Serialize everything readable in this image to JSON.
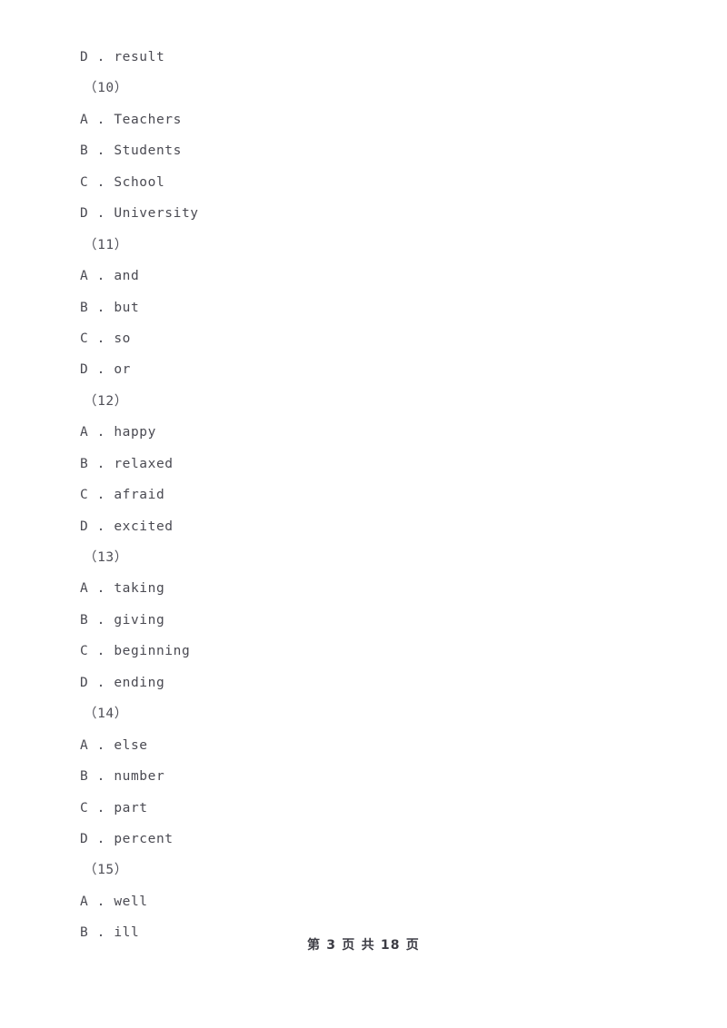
{
  "document": {
    "page_background": "#ffffff",
    "text_color": "#4a4a52",
    "lines": [
      {
        "type": "option",
        "text": "D . result"
      },
      {
        "type": "qnum",
        "text": "（10）"
      },
      {
        "type": "option",
        "text": "A . Teachers"
      },
      {
        "type": "option",
        "text": "B . Students"
      },
      {
        "type": "option",
        "text": "C . School"
      },
      {
        "type": "option",
        "text": "D . University"
      },
      {
        "type": "qnum",
        "text": "（11）"
      },
      {
        "type": "option",
        "text": "A . and"
      },
      {
        "type": "option",
        "text": "B . but"
      },
      {
        "type": "option",
        "text": "C . so"
      },
      {
        "type": "option",
        "text": "D . or"
      },
      {
        "type": "qnum",
        "text": "（12）"
      },
      {
        "type": "option",
        "text": "A . happy"
      },
      {
        "type": "option",
        "text": "B . relaxed"
      },
      {
        "type": "option",
        "text": "C . afraid"
      },
      {
        "type": "option",
        "text": "D . excited"
      },
      {
        "type": "qnum",
        "text": "（13）"
      },
      {
        "type": "option",
        "text": "A . taking"
      },
      {
        "type": "option",
        "text": "B . giving"
      },
      {
        "type": "option",
        "text": "C . beginning"
      },
      {
        "type": "option",
        "text": "D . ending"
      },
      {
        "type": "qnum",
        "text": "（14）"
      },
      {
        "type": "option",
        "text": "A . else"
      },
      {
        "type": "option",
        "text": "B . number"
      },
      {
        "type": "option",
        "text": "C . part"
      },
      {
        "type": "option",
        "text": "D . percent"
      },
      {
        "type": "qnum",
        "text": "（15）"
      },
      {
        "type": "option",
        "text": "A . well"
      },
      {
        "type": "option",
        "text": "B . ill"
      }
    ]
  },
  "footer": {
    "page_label": "第 3 页 共 18 页",
    "current_page": "3",
    "total_pages": "18"
  }
}
